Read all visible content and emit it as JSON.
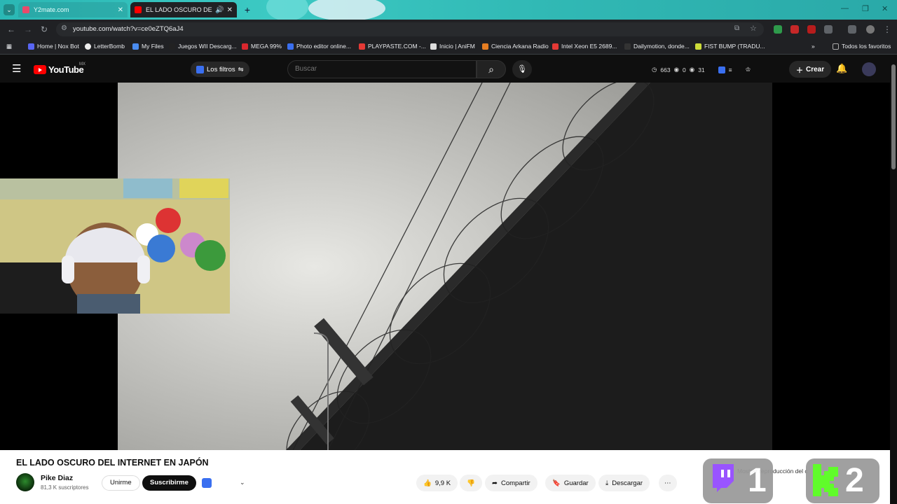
{
  "browser": {
    "tabs": [
      {
        "title": "Y2mate.com",
        "active": false
      },
      {
        "title": "EL LADO OSCURO DEL INTE",
        "active": true
      }
    ],
    "url": "youtube.com/watch?v=ce0eZTQ6aJ4",
    "bookmarks": [
      "Home | Nox Bot",
      "LetterBomb",
      "My Files",
      "Juegos WII Descarg...",
      "MEGA 99%",
      "Photo editor online...",
      "PLAYPASTE.COM -...",
      "Inicio | AniFM",
      "Ciencia Arkana Radio",
      "Intel Xeon E5 2689...",
      "Dailymotion, donde...",
      "FIST BUMP (TRADU..."
    ],
    "all_bookmarks_label": "Todos los favoritos"
  },
  "youtube": {
    "logo_text": "YouTube",
    "country_code": "MX",
    "filters_label": "Los filtros",
    "search_placeholder": "Buscar",
    "stats": {
      "a": "663",
      "b": "0",
      "c": "31"
    },
    "create_label": "Crear"
  },
  "video": {
    "title": "EL LADO OSCURO DEL INTERNET EN JAPÓN",
    "channel_name": "Pike Diaz",
    "subscribers": "81,3 K suscriptores",
    "join_label": "Unirme",
    "subscribe_label": "Suscribirme",
    "likes": "9,9 K",
    "share_label": "Compartir",
    "save_label": "Guardar",
    "download_label": "Descargar",
    "overlay_text": "Mostrar reproducción del c"
  },
  "stream_badges": [
    "1",
    "2"
  ],
  "colors": {
    "tabstrip": "#2ab7b4",
    "yt_red": "#ff0000",
    "twitch_purple": "#9146ff",
    "kick_green": "#53fc18"
  }
}
